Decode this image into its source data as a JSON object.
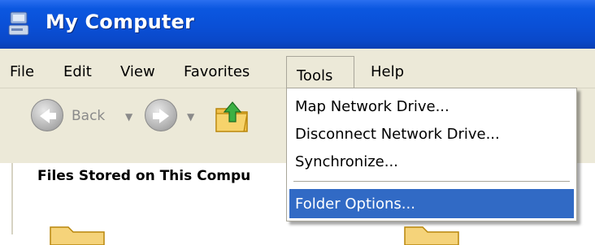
{
  "window": {
    "title": "My Computer"
  },
  "menubar": {
    "items": [
      {
        "label": "File"
      },
      {
        "label": "Edit"
      },
      {
        "label": "View"
      },
      {
        "label": "Favorites"
      },
      {
        "label": "Tools"
      },
      {
        "label": "Help"
      }
    ]
  },
  "toolbar": {
    "back_label": "Back",
    "back_icon": "back-arrow-icon",
    "forward_icon": "forward-arrow-icon",
    "up_icon": "folder-up-icon"
  },
  "pane": {
    "header": "Files Stored on This Compu"
  },
  "tools_menu": {
    "items": [
      {
        "label": "Map Network Drive..."
      },
      {
        "label": "Disconnect Network Drive..."
      },
      {
        "label": "Synchronize..."
      },
      {
        "label": "Folder Options..."
      }
    ],
    "highlighted": "Folder Options..."
  },
  "colors": {
    "titlebar": "#0a4fd6",
    "menubar": "#ece9d8",
    "highlight": "#316ac5"
  }
}
